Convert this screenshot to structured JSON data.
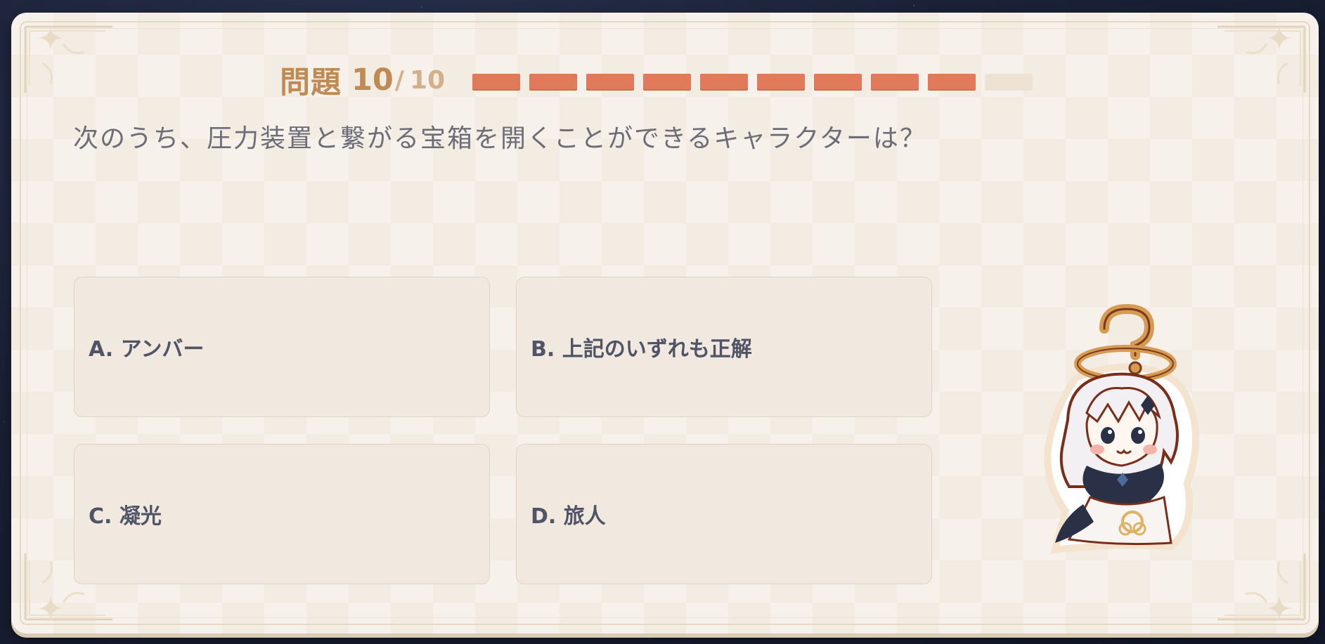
{
  "quiz": {
    "question_label": "問題",
    "current": "10",
    "slash": "/",
    "total": "10",
    "progress": {
      "filled": 9,
      "total": 10
    },
    "question_text": "次のうち、圧力装置と繋がる宝箱を開くことができるキャラクターは？",
    "options": [
      {
        "text": "A. アンバー"
      },
      {
        "text": "B. 上記のいずれも正解"
      },
      {
        "text": "C. 凝光"
      },
      {
        "text": "D. 旅人"
      }
    ]
  },
  "colors": {
    "accent": "#c08a54",
    "progress_filled": "#e07a5a",
    "progress_empty": "#eee2d4",
    "option_bg": "#f1e8df",
    "question_text": "#6d6d78"
  },
  "mascot": {
    "icon": "paimon-mascot-icon"
  }
}
